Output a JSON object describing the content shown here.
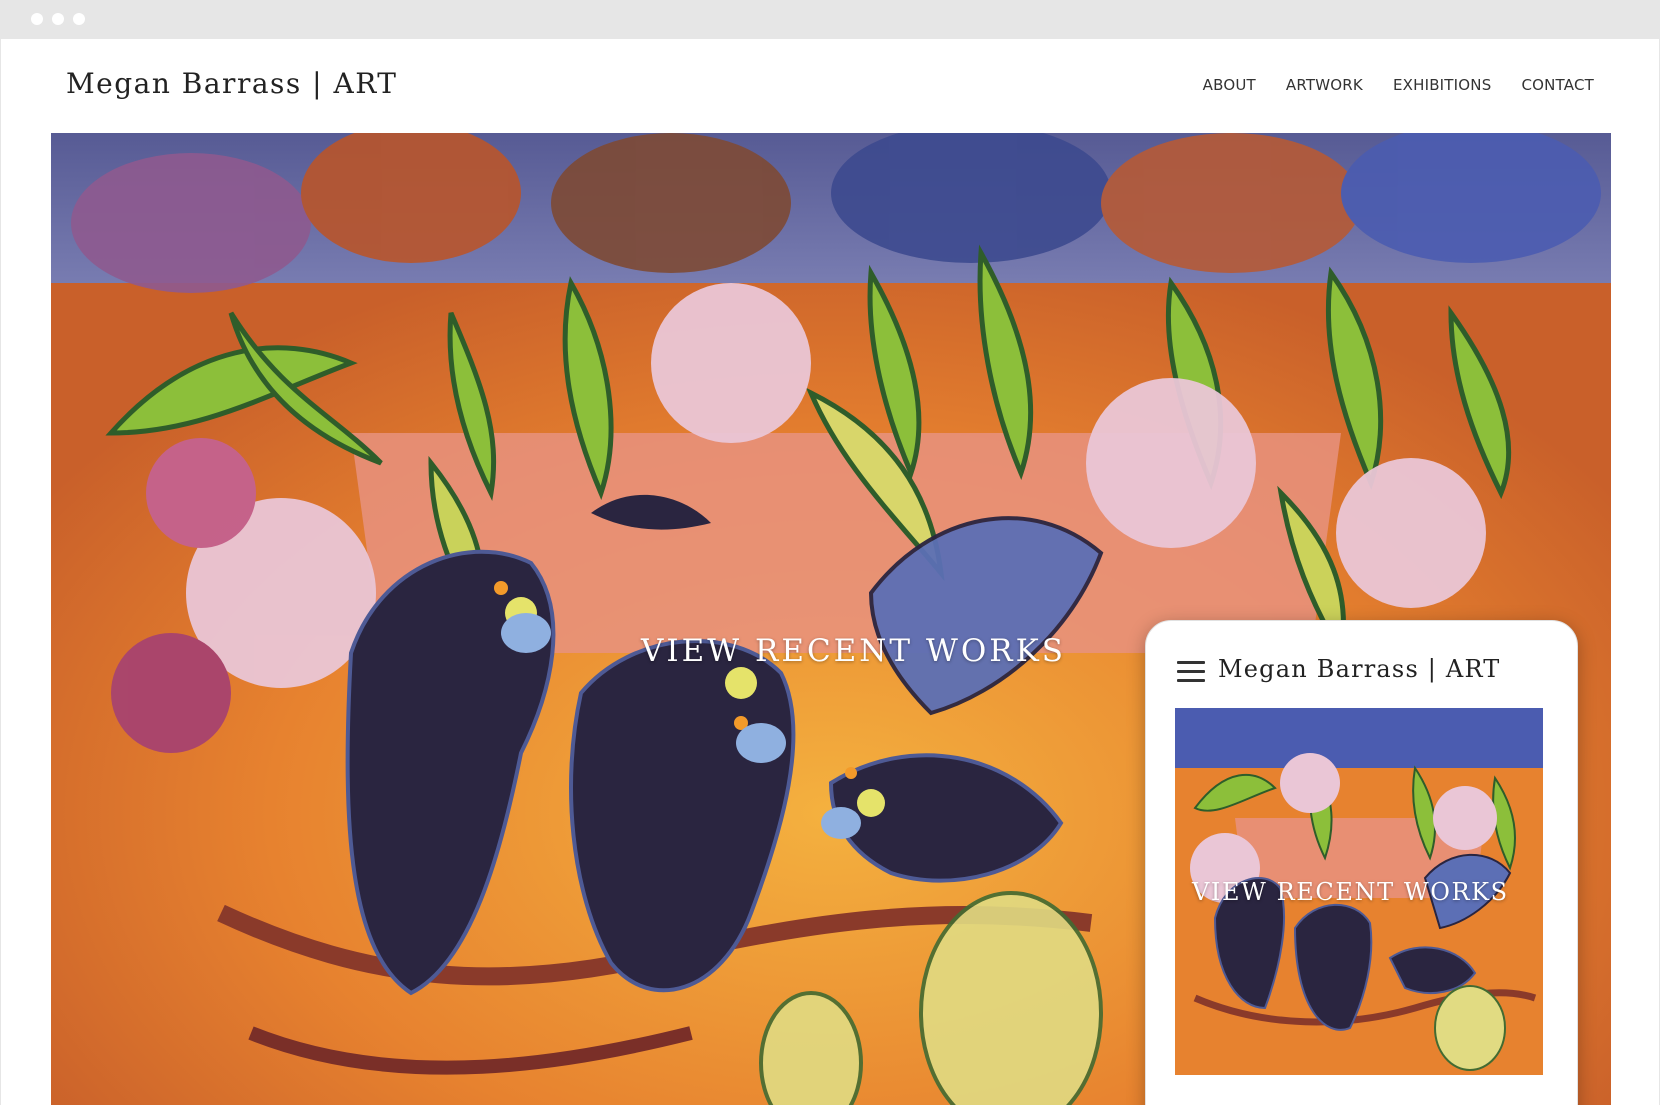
{
  "window": {
    "controls": [
      "dot",
      "dot",
      "dot"
    ]
  },
  "site": {
    "logo": "Megan Barrass | ART",
    "nav": [
      {
        "label": "ABOUT"
      },
      {
        "label": "ARTWORK"
      },
      {
        "label": "EXHIBITIONS"
      },
      {
        "label": "CONTACT"
      }
    ]
  },
  "hero": {
    "cta": "VIEW RECENT WORKS",
    "artwork_palette": {
      "background": "#d46b2a",
      "warm_orange": "#f0a53a",
      "pink_wall": "#e8927f",
      "cockatoo_black": "#2a2540",
      "foliage_green": "#6f9c3a",
      "banksia_pink": "#e6b8cc",
      "sky_blue": "#5c6fb5"
    }
  },
  "mobile_preview": {
    "menu_icon": "hamburger-icon",
    "logo": "Megan Barrass | ART",
    "cta": "VIEW RECENT WORKS"
  }
}
